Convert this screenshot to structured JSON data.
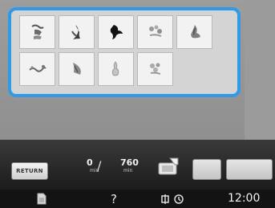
{
  "patterns": [
    {
      "icon": "tree-motif-icon"
    },
    {
      "icon": "leaf-bird-motif-icon"
    },
    {
      "icon": "bird-motif-icon"
    },
    {
      "icon": "flower-spray-motif-icon"
    },
    {
      "icon": "plant-motif-icon"
    },
    {
      "icon": "garland-motif-icon"
    },
    {
      "icon": "bouquet-motif-icon"
    },
    {
      "icon": "vase-motif-icon"
    },
    {
      "icon": "floral-motif-icon"
    }
  ],
  "status": {
    "return_label": "RETURN",
    "current_stitches": "0",
    "current_unit": "min",
    "total_stitches": "760",
    "total_unit": "min"
  },
  "bottom": {
    "time": "12:00",
    "help_label": "?"
  },
  "colors": {
    "selection_border": "#2f9be8",
    "panel_bg": "#d4d4d4",
    "status_bar_bg": "#1c1c1c"
  }
}
